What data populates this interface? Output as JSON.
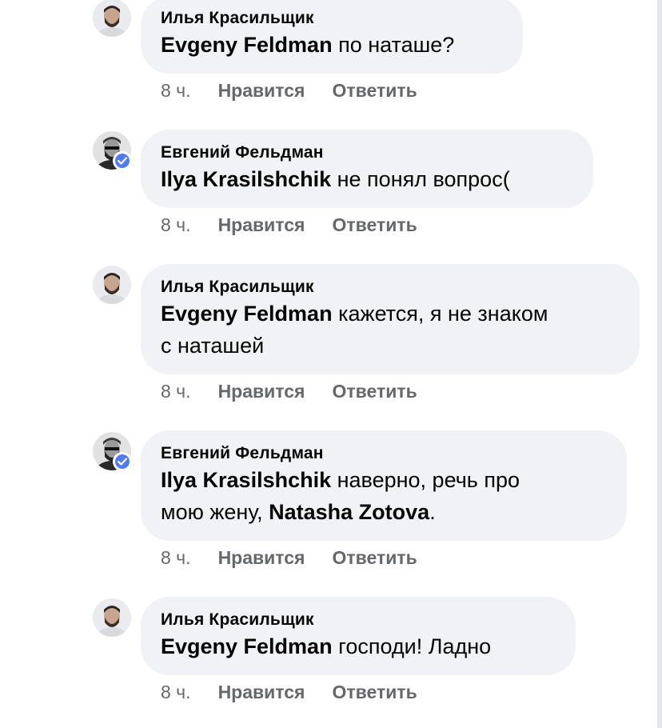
{
  "comments": [
    {
      "author": "Илья Красильщик",
      "mention": "Evgeny Feldman",
      "text": " по наташе?",
      "time": "8 ч.",
      "like": "Нравится",
      "reply": "Ответить",
      "avatar": "avatar-man-bearded",
      "verified": false
    },
    {
      "author": "Евгений Фельдман",
      "mention": "Ilya Krasilshchik",
      "text": " не понял вопрос(",
      "time": "8 ч.",
      "like": "Нравится",
      "reply": "Ответить",
      "avatar": "avatar-man-bw",
      "verified": true
    },
    {
      "author": "Илья Красильщик",
      "mention": "Evgeny Feldman",
      "text_line1": " кажется, я не знаком",
      "text_line2": "с наташей",
      "time": "8 ч.",
      "like": "Нравится",
      "reply": "Ответить",
      "avatar": "avatar-man-bearded",
      "verified": false
    },
    {
      "author": "Евгений Фельдман",
      "mention": "Ilya Krasilshchik",
      "text_line1": " наверно, речь про",
      "text_line2_prefix": "мою жену, ",
      "mention2": "Natasha Zotova",
      "text_line2_suffix": ".",
      "time": "8 ч.",
      "like": "Нравится",
      "reply": "Ответить",
      "avatar": "avatar-man-bw",
      "verified": true
    },
    {
      "author": "Илья Красильщик",
      "mention": "Evgeny Feldman",
      "text": " господи! Ладно",
      "time": "8 ч.",
      "like": "Нравится",
      "reply": "Ответить",
      "avatar": "avatar-man-bearded",
      "verified": false
    }
  ],
  "colors": {
    "bubble": "#f0f2f5",
    "meta_text": "#65676b",
    "verified_badge": "#4f7cf5"
  }
}
